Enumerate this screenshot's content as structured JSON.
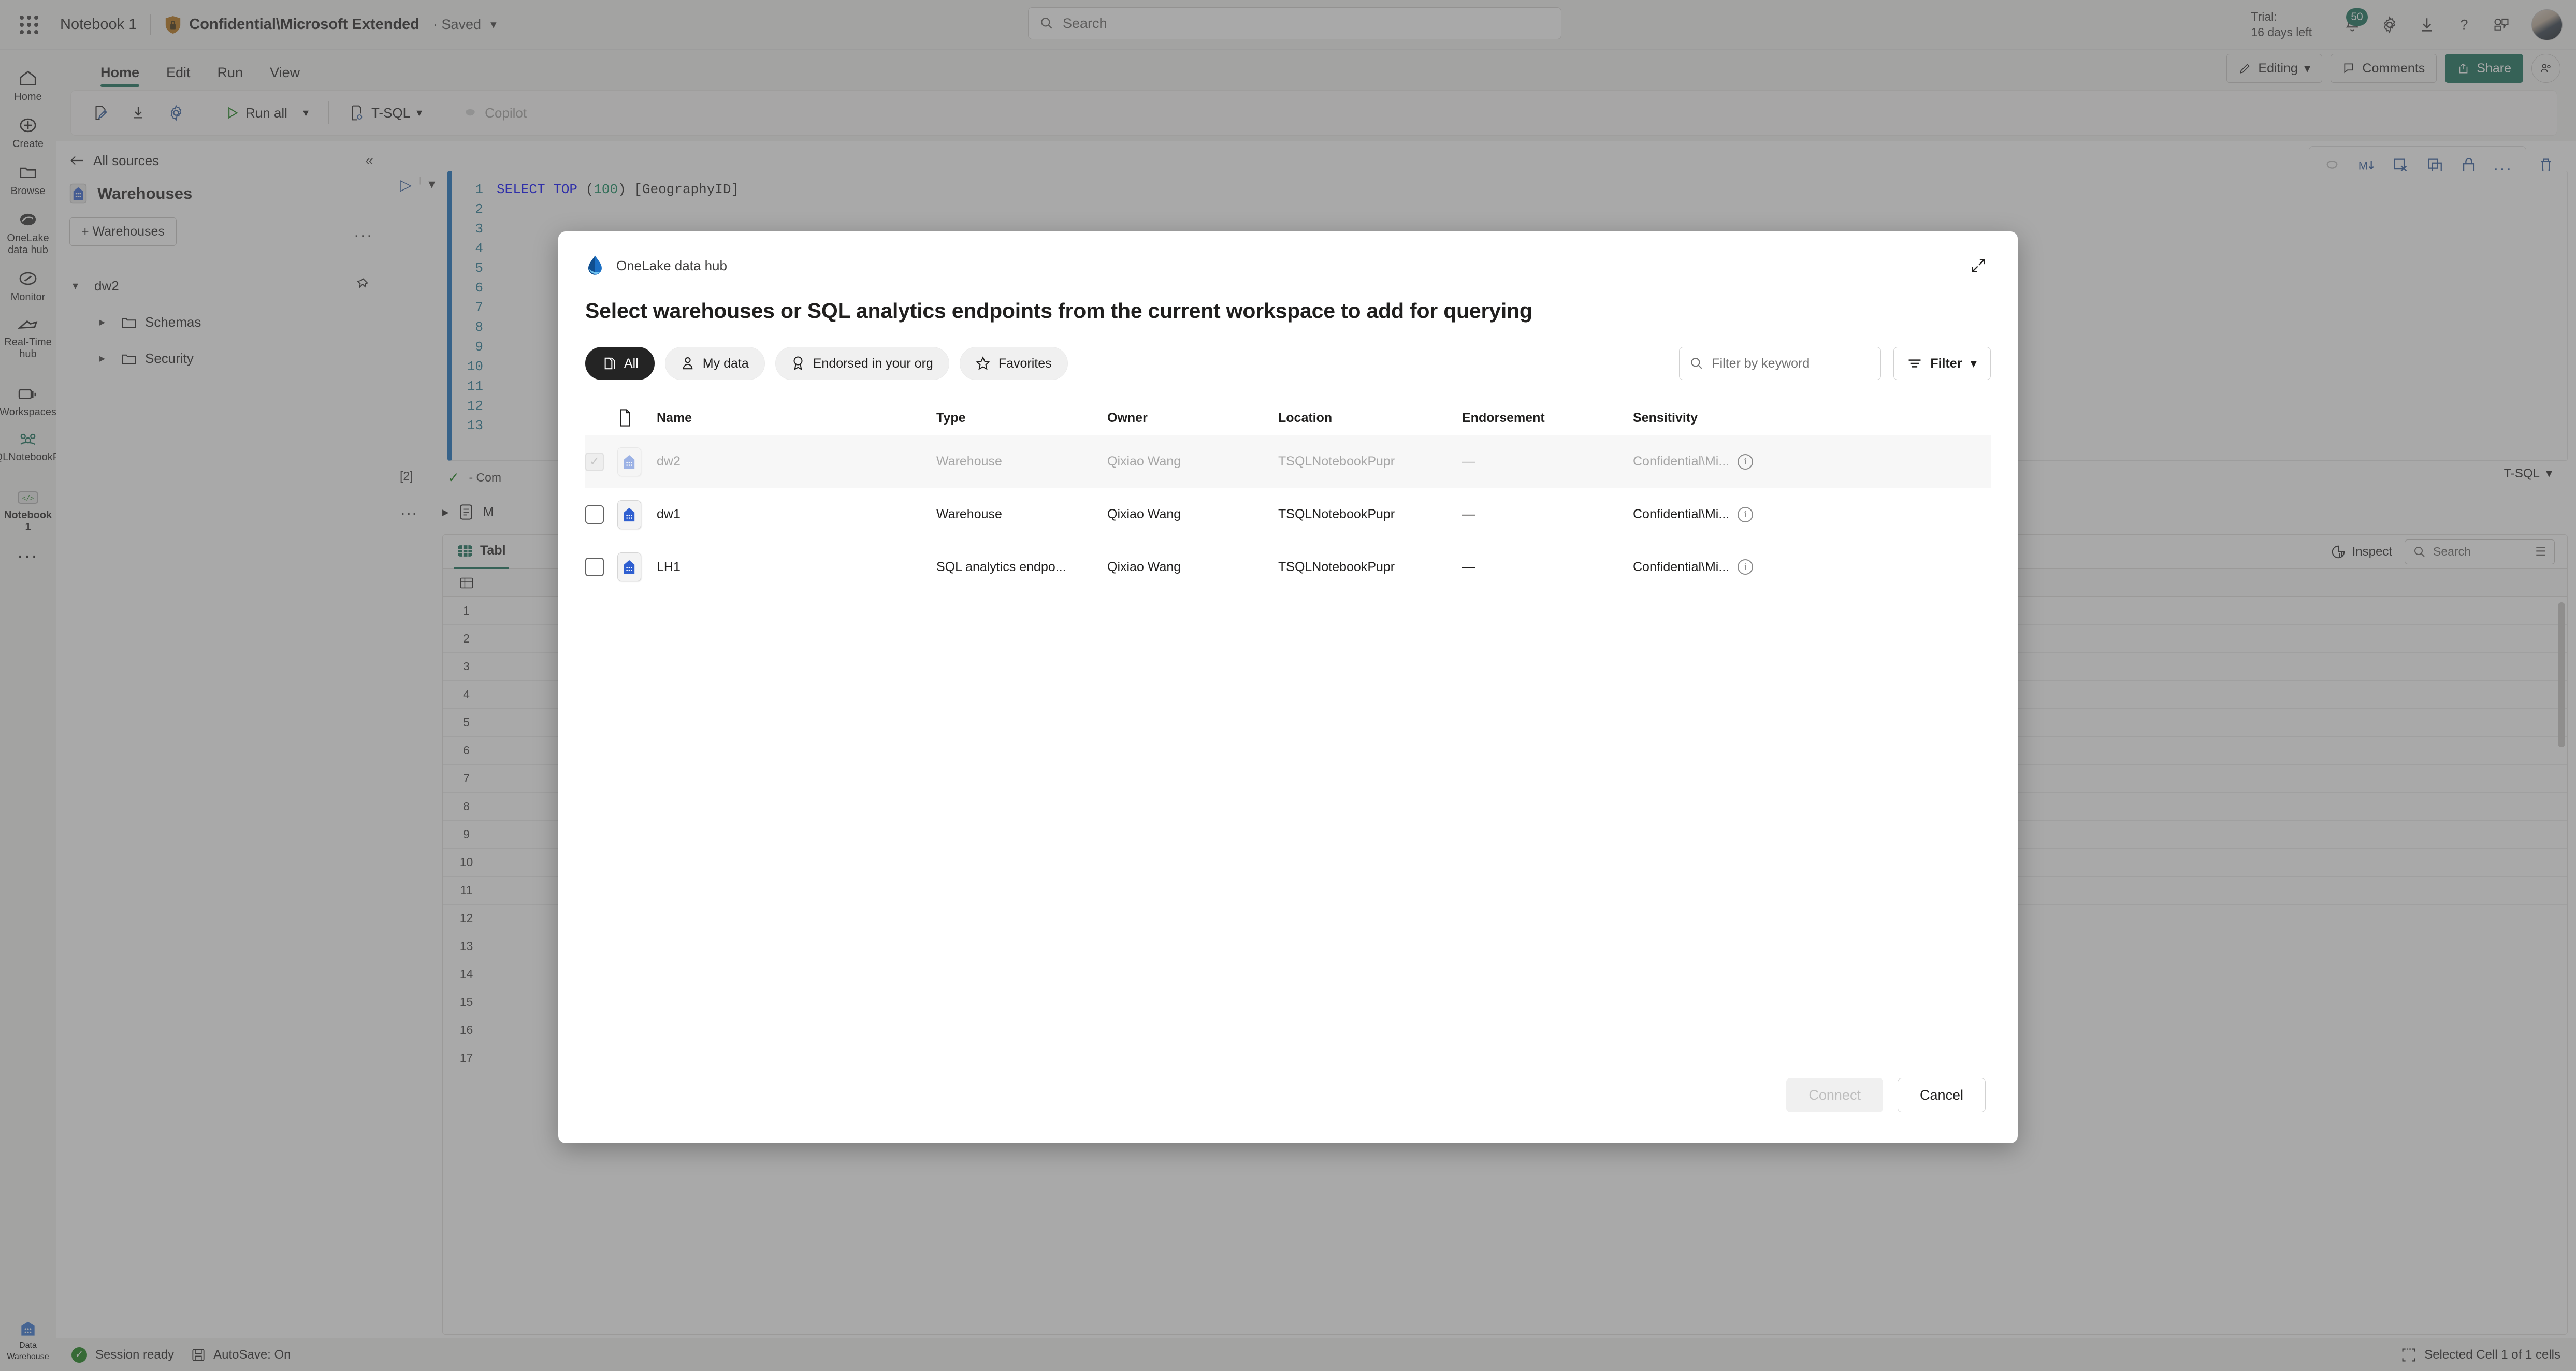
{
  "suitebar": {
    "notebook_title": "Notebook 1",
    "sensitivity_label": "Confidential\\Microsoft Extended",
    "saved_text": "· Saved",
    "search_placeholder": "Search",
    "trial_line1": "Trial:",
    "trial_line2": "16 days left",
    "notification_count": "50"
  },
  "ribbon": {
    "tabs": [
      {
        "label": "Home",
        "active": true
      },
      {
        "label": "Edit",
        "active": false
      },
      {
        "label": "Run",
        "active": false
      },
      {
        "label": "View",
        "active": false
      }
    ],
    "commands": {
      "run_all": "Run all",
      "language": "T-SQL",
      "copilot": "Copilot"
    },
    "right": {
      "editing": "Editing",
      "comments": "Comments",
      "share": "Share"
    }
  },
  "rail": {
    "items": [
      {
        "label": "Home",
        "icon": "home-icon"
      },
      {
        "label": "Create",
        "icon": "plus-circle-icon"
      },
      {
        "label": "Browse",
        "icon": "folder-icon"
      },
      {
        "label": "OneLake data hub",
        "icon": "onelake-icon"
      },
      {
        "label": "Monitor",
        "icon": "monitor-icon"
      },
      {
        "label": "Real-Time hub",
        "icon": "realtime-icon"
      },
      {
        "label": "Workspaces",
        "icon": "workspaces-icon"
      },
      {
        "label": "TSQLNotebookPupr",
        "icon": "workspace-people-icon"
      },
      {
        "label": "Notebook 1",
        "icon": "notebook-code-icon"
      }
    ],
    "more": "...",
    "bottom_label_line1": "Data",
    "bottom_label_line2": "Warehouse"
  },
  "explorer": {
    "back_label": "All sources",
    "title": "Warehouses",
    "add_button": "+ Warehouses",
    "more": "...",
    "tree": [
      {
        "label": "dw2",
        "level": 1,
        "expanded": true,
        "pinned": true
      },
      {
        "label": "Schemas",
        "level": 2,
        "expanded": false
      },
      {
        "label": "Security",
        "level": 2,
        "expanded": false
      }
    ]
  },
  "notebook": {
    "code_lines": [
      "1",
      "2",
      "3",
      "4",
      "5",
      "6",
      "7",
      "8",
      "9",
      "10",
      "11",
      "12",
      "13"
    ],
    "code_first_line": "SELECT TOP (100) [GeographyID]",
    "exec_count": "[2]",
    "status_text": "- Com",
    "language_badge": "T-SQL",
    "message_row": "M",
    "results": {
      "tab_label": "Tabl",
      "inspect": "Inspect",
      "search_placeholder": "Search",
      "row_numbers": [
        "1",
        "2",
        "3",
        "4",
        "5",
        "6",
        "7",
        "8",
        "9",
        "10",
        "11",
        "12",
        "13",
        "14",
        "15",
        "16",
        "17"
      ]
    }
  },
  "statusbar": {
    "session": "Session ready",
    "autosave": "AutoSave: On",
    "selection": "Selected Cell 1 of 1 cells"
  },
  "modal": {
    "brand": "OneLake data hub",
    "title": "Select warehouses or SQL analytics endpoints from the current workspace to add for querying",
    "pills": [
      {
        "label": "All",
        "icon": "all-stack-icon",
        "active": true
      },
      {
        "label": "My data",
        "icon": "person-icon",
        "active": false
      },
      {
        "label": "Endorsed in your org",
        "icon": "badge-icon",
        "active": false
      },
      {
        "label": "Favorites",
        "icon": "star-icon",
        "active": false
      }
    ],
    "keyword_placeholder": "Filter by keyword",
    "filter_button": "Filter",
    "columns": [
      "Name",
      "Type",
      "Owner",
      "Location",
      "Endorsement",
      "Sensitivity"
    ],
    "rows": [
      {
        "name": "dw2",
        "type": "Warehouse",
        "owner": "Qixiao Wang",
        "location": "TSQLNotebookPupr",
        "endorsement": "—",
        "sensitivity": "Confidential\\Mi...",
        "checked": true,
        "disabled": true
      },
      {
        "name": "dw1",
        "type": "Warehouse",
        "owner": "Qixiao Wang",
        "location": "TSQLNotebookPupr",
        "endorsement": "—",
        "sensitivity": "Confidential\\Mi...",
        "checked": false,
        "disabled": false
      },
      {
        "name": "LH1",
        "type": "SQL analytics endpo...",
        "owner": "Qixiao Wang",
        "location": "TSQLNotebookPupr",
        "endorsement": "—",
        "sensitivity": "Confidential\\Mi...",
        "checked": false,
        "disabled": false
      }
    ],
    "connect_button": "Connect",
    "cancel_button": "Cancel"
  },
  "colors": {
    "accent_green": "#0f6b55",
    "link_blue": "#2b579a",
    "warehouse_blue": "#2b5fd9",
    "pill_active": "#242424"
  }
}
